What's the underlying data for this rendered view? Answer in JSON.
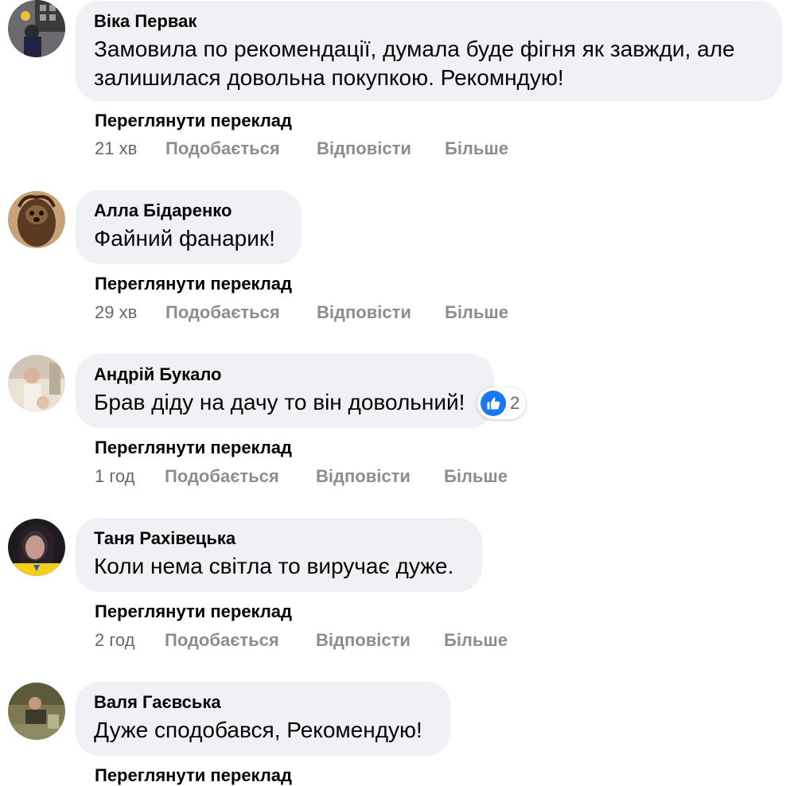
{
  "comments": [
    {
      "author": "Віка Первак",
      "text_lines": [
        "Замовила по рекомендації, думала буде фігня як завжди, але",
        "залишилася довольна покупкою. Рекомндую!"
      ],
      "translate_label": "Переглянути переклад",
      "time": "21 хв",
      "like_label": "Подобається",
      "reply_label": "Відповісти",
      "more_label": "Більше",
      "avatar_icon": "profile-photo"
    },
    {
      "author": "Алла Бідаренко",
      "text_lines": [
        "Файний фанарик!"
      ],
      "translate_label": "Переглянути переклад",
      "time": "29 хв",
      "like_label": "Подобається",
      "reply_label": "Відповісти",
      "more_label": "Більше",
      "avatar_icon": "profile-photo-dog"
    },
    {
      "author": "Андрій Букало",
      "text_lines": [
        "Брав діду на дачу то він довольний!"
      ],
      "translate_label": "Переглянути переклад",
      "time": "1 год",
      "like_label": "Подобається",
      "reply_label": "Відповісти",
      "more_label": "Більше",
      "reaction_count": "2",
      "reaction_icon": "like-icon",
      "avatar_icon": "profile-photo"
    },
    {
      "author": "Таня Рахівецька",
      "text_lines": [
        "Коли нема світла то виручає дуже."
      ],
      "translate_label": "Переглянути переклад",
      "time": "2 год",
      "like_label": "Подобається",
      "reply_label": "Відповісти",
      "more_label": "Більше",
      "avatar_icon": "profile-photo"
    },
    {
      "author": "Валя Гаєвська",
      "text_lines": [
        "Дуже сподобався, Рекомендую!"
      ],
      "translate_label": "Переглянути переклад",
      "avatar_icon": "profile-photo"
    }
  ],
  "colors": {
    "bubble": "#eff1f4",
    "action_text": "#8a8d91",
    "time_text": "#65676b",
    "like_blue": "#1877f2"
  }
}
